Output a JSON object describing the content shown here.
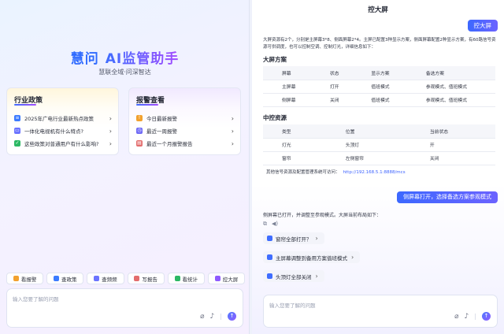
{
  "left": {
    "brand_title_1": "慧问",
    "brand_title_2": "AI监管助手",
    "brand_subtitle": "慧联全域·问深智达",
    "card_industry": {
      "title": "行业政策",
      "items": [
        {
          "label": "2025年广电行业最新热点政策",
          "icon": "policy-doc-icon"
        },
        {
          "label": "一体化电视机有什么特点?",
          "icon": "tv-icon"
        },
        {
          "label": "这些政策对普通用户有什么影响?",
          "icon": "impact-icon"
        }
      ]
    },
    "card_alerts": {
      "title": "报警查看",
      "items": [
        {
          "label": "今日最新报警",
          "icon": "alarm-icon"
        },
        {
          "label": "最近一周报警",
          "icon": "week-alarm-icon"
        },
        {
          "label": "最近一个月报警报告",
          "icon": "month-report-icon"
        }
      ]
    },
    "shortcuts": [
      "看报警",
      "查政策",
      "查频频",
      "写报告",
      "看统计",
      "控大屏"
    ],
    "input_placeholder": "输入您要了解的问题"
  },
  "right": {
    "title": "控大屏",
    "user_msg_1": "控大屏",
    "intro": "大屏资源有2个，分别是主屏幕3*8、侧面屏幕2*4。主屏已配置3种显示方案，侧面屏幕配置2种显示方案，有60路信号资源可供调度，也可以控制空调、控制灯光，详细信息如下：",
    "section_screens": "大屏方案",
    "screens_table": {
      "headers": [
        "屏幕",
        "状态",
        "显示方案",
        "备选方案"
      ],
      "rows": [
        [
          "主屏幕",
          "打开",
          "值班模式",
          "参观模式、值班模式"
        ],
        [
          "侧屏幕",
          "关闭",
          "值班模式",
          "参观模式、值班模式"
        ]
      ]
    },
    "section_control": "中控资源",
    "control_table": {
      "headers": [
        "类型",
        "位置",
        "当前状态"
      ],
      "rows": [
        [
          "灯光",
          "头顶灯",
          "开"
        ],
        [
          "窗帘",
          "左侧窗帘",
          "关闭"
        ]
      ]
    },
    "note_label": "其他信号资源及配置管理系统可访问：",
    "note_link": "http://192.168.5.1:8888/mcs",
    "user_msg_2": "侧屏幕打开，选择备选方案参观模式",
    "reply": "侧屏幕已打开，并调整至参观模式。大屏当前布局如下：",
    "suggestions": [
      "窗帘全部打开？",
      "主屏幕调整到备用方案值班模式",
      "头顶灯全部关闭"
    ],
    "input_placeholder": "输入您要了解的问题"
  }
}
